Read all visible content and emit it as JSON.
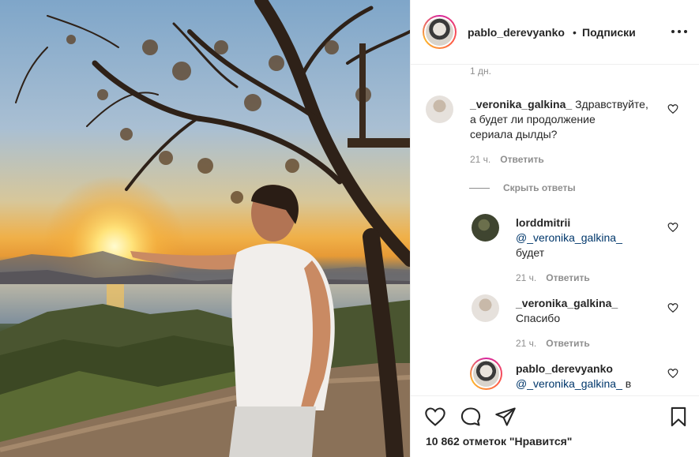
{
  "post": {
    "author": "pablo_derevyanko",
    "separator": "•",
    "follow_status": "Подписки",
    "likes_text": "10 862 отметок \"Нравится\""
  },
  "comments": {
    "top_timestamp": "1 дн.",
    "items": [
      {
        "username": "_veronika_galkina_",
        "line1_rest": " Здравствуйте,",
        "line2": "а будет ли продолжение",
        "line3": "сериала дылды?",
        "time": "21 ч.",
        "reply_label": "Ответить"
      }
    ],
    "hide_replies_label": "Скрыть ответы",
    "replies": [
      {
        "username": "lorddmitrii",
        "mention": "@_veronika_galkina_",
        "text": "будет",
        "time": "21 ч.",
        "reply_label": "Ответить"
      },
      {
        "username": "_veronika_galkina_",
        "text": "Спасибо",
        "time": "21 ч.",
        "reply_label": "Ответить"
      },
      {
        "username": "pablo_derevyanko",
        "mention": "@_veronika_galkina_",
        "text_tail": " в"
      }
    ]
  },
  "icons": {
    "more": "more-horizontal-icon",
    "like": "heart-icon",
    "comment": "comment-bubble-icon",
    "share": "paper-plane-icon",
    "save": "bookmark-icon"
  }
}
